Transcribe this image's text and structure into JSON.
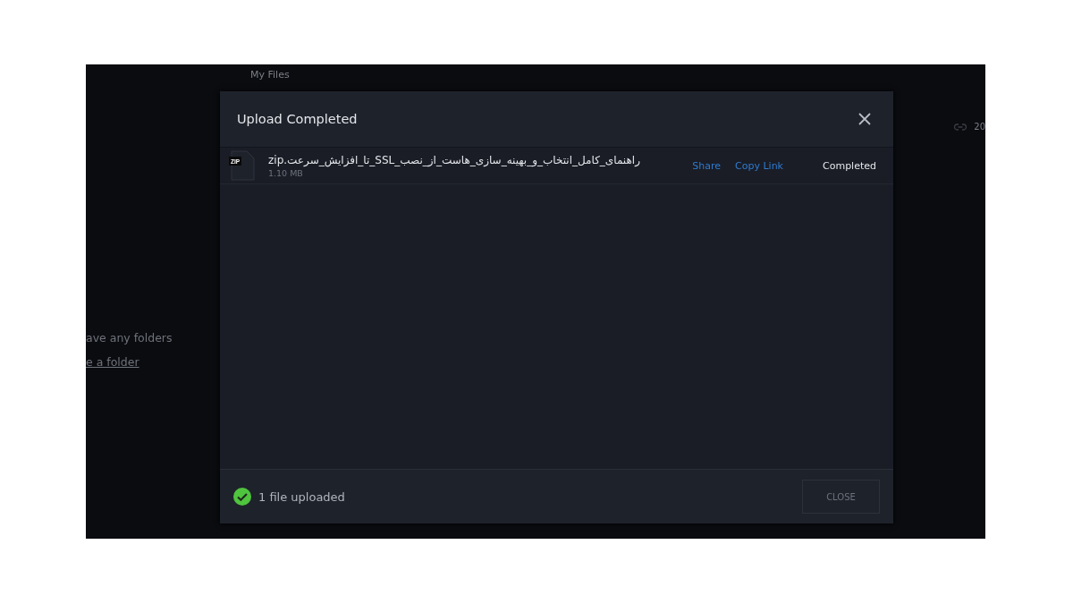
{
  "background": {
    "breadcrumb": "My Files",
    "empty_message": "ave any folders",
    "create_link": "e a folder",
    "column_text": "20"
  },
  "dialog": {
    "title": "Upload Completed",
    "files": [
      {
        "type": "ZIP",
        "name": "راهنمای_کامل_انتخاب_و_بهینه_سازی_هاست_از_نصب_SSL_تا_افزایش_سرعت.zip",
        "size": "1.10 MB",
        "actions": [
          "Share",
          "Copy Link"
        ],
        "status": "Completed"
      }
    ],
    "summary": "1 file uploaded",
    "close_button": "CLOSE"
  }
}
